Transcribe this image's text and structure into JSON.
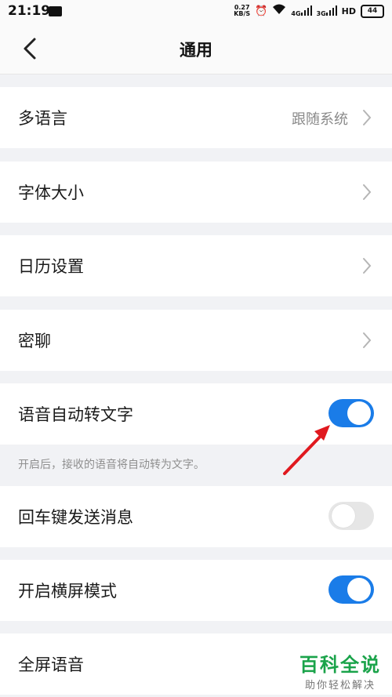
{
  "status_bar": {
    "time": "21:19",
    "net_speed_value": "0.27",
    "net_speed_unit": "KB/S",
    "signal_1": "4G",
    "signal_2": "3G",
    "hd": "HD",
    "battery": "44"
  },
  "header": {
    "title": "通用"
  },
  "settings": {
    "language_label": "多语言",
    "language_value": "跟随系统",
    "font_size_label": "字体大小",
    "calendar_label": "日历设置",
    "secret_chat_label": "密聊",
    "voice_to_text_label": "语音自动转文字",
    "voice_to_text_on": true,
    "voice_to_text_hint": "开启后，接收的语音将自动转为文字。",
    "enter_send_label": "回车键发送消息",
    "enter_send_on": false,
    "landscape_label": "开启横屏模式",
    "landscape_on": true,
    "fullscreen_voice_label": "全屏语音"
  },
  "watermark": {
    "title": "百科全说",
    "subtitle": "助你轻松解决"
  },
  "colors": {
    "accent": "#1a7ce8",
    "annotation_arrow": "#e0191f",
    "watermark_green": "#1aa34a"
  }
}
